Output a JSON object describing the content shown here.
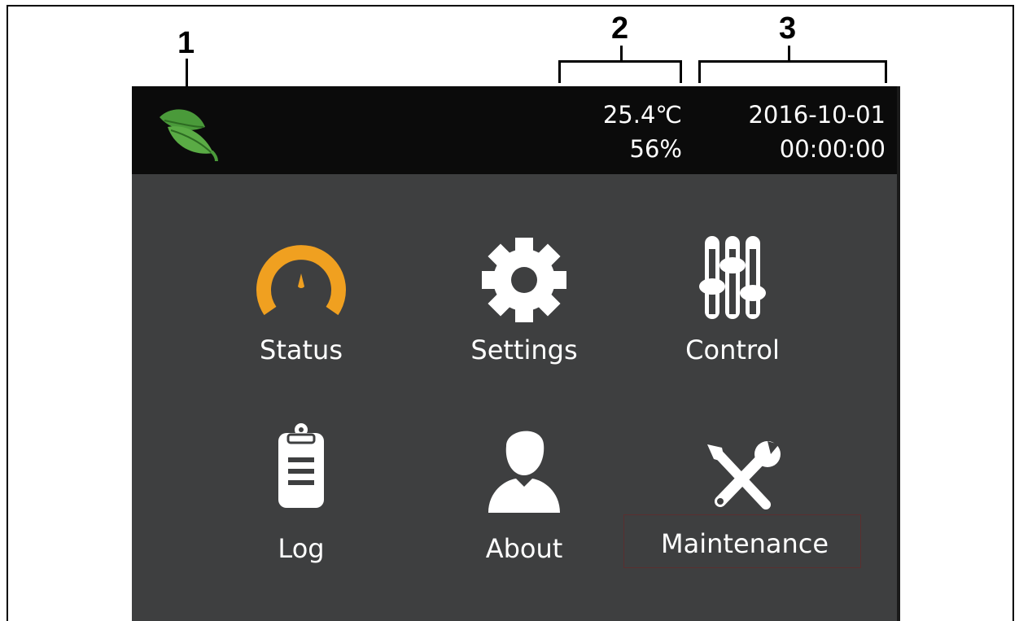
{
  "callouts": {
    "one": "1",
    "two": "2",
    "three": "3"
  },
  "header": {
    "logo_icon": "leaf-icon",
    "temperature": "25.4℃",
    "humidity": "56%",
    "date": "2016-10-01",
    "time": "00:00:00"
  },
  "menu": {
    "items": [
      {
        "label": "Status",
        "icon": "gauge-icon"
      },
      {
        "label": "Settings",
        "icon": "gear-icon"
      },
      {
        "label": "Control",
        "icon": "sliders-icon"
      },
      {
        "label": "Log",
        "icon": "clipboard-icon"
      },
      {
        "label": "About",
        "icon": "user-icon"
      },
      {
        "label": "Maintenance",
        "icon": "tools-icon"
      }
    ]
  },
  "colors": {
    "screen_bg": "#3e3f40",
    "topbar_bg": "#0b0b0b",
    "leaf_green": "#4a9a3a",
    "status_orange": "#f0a020",
    "icon_white": "#ffffff"
  }
}
